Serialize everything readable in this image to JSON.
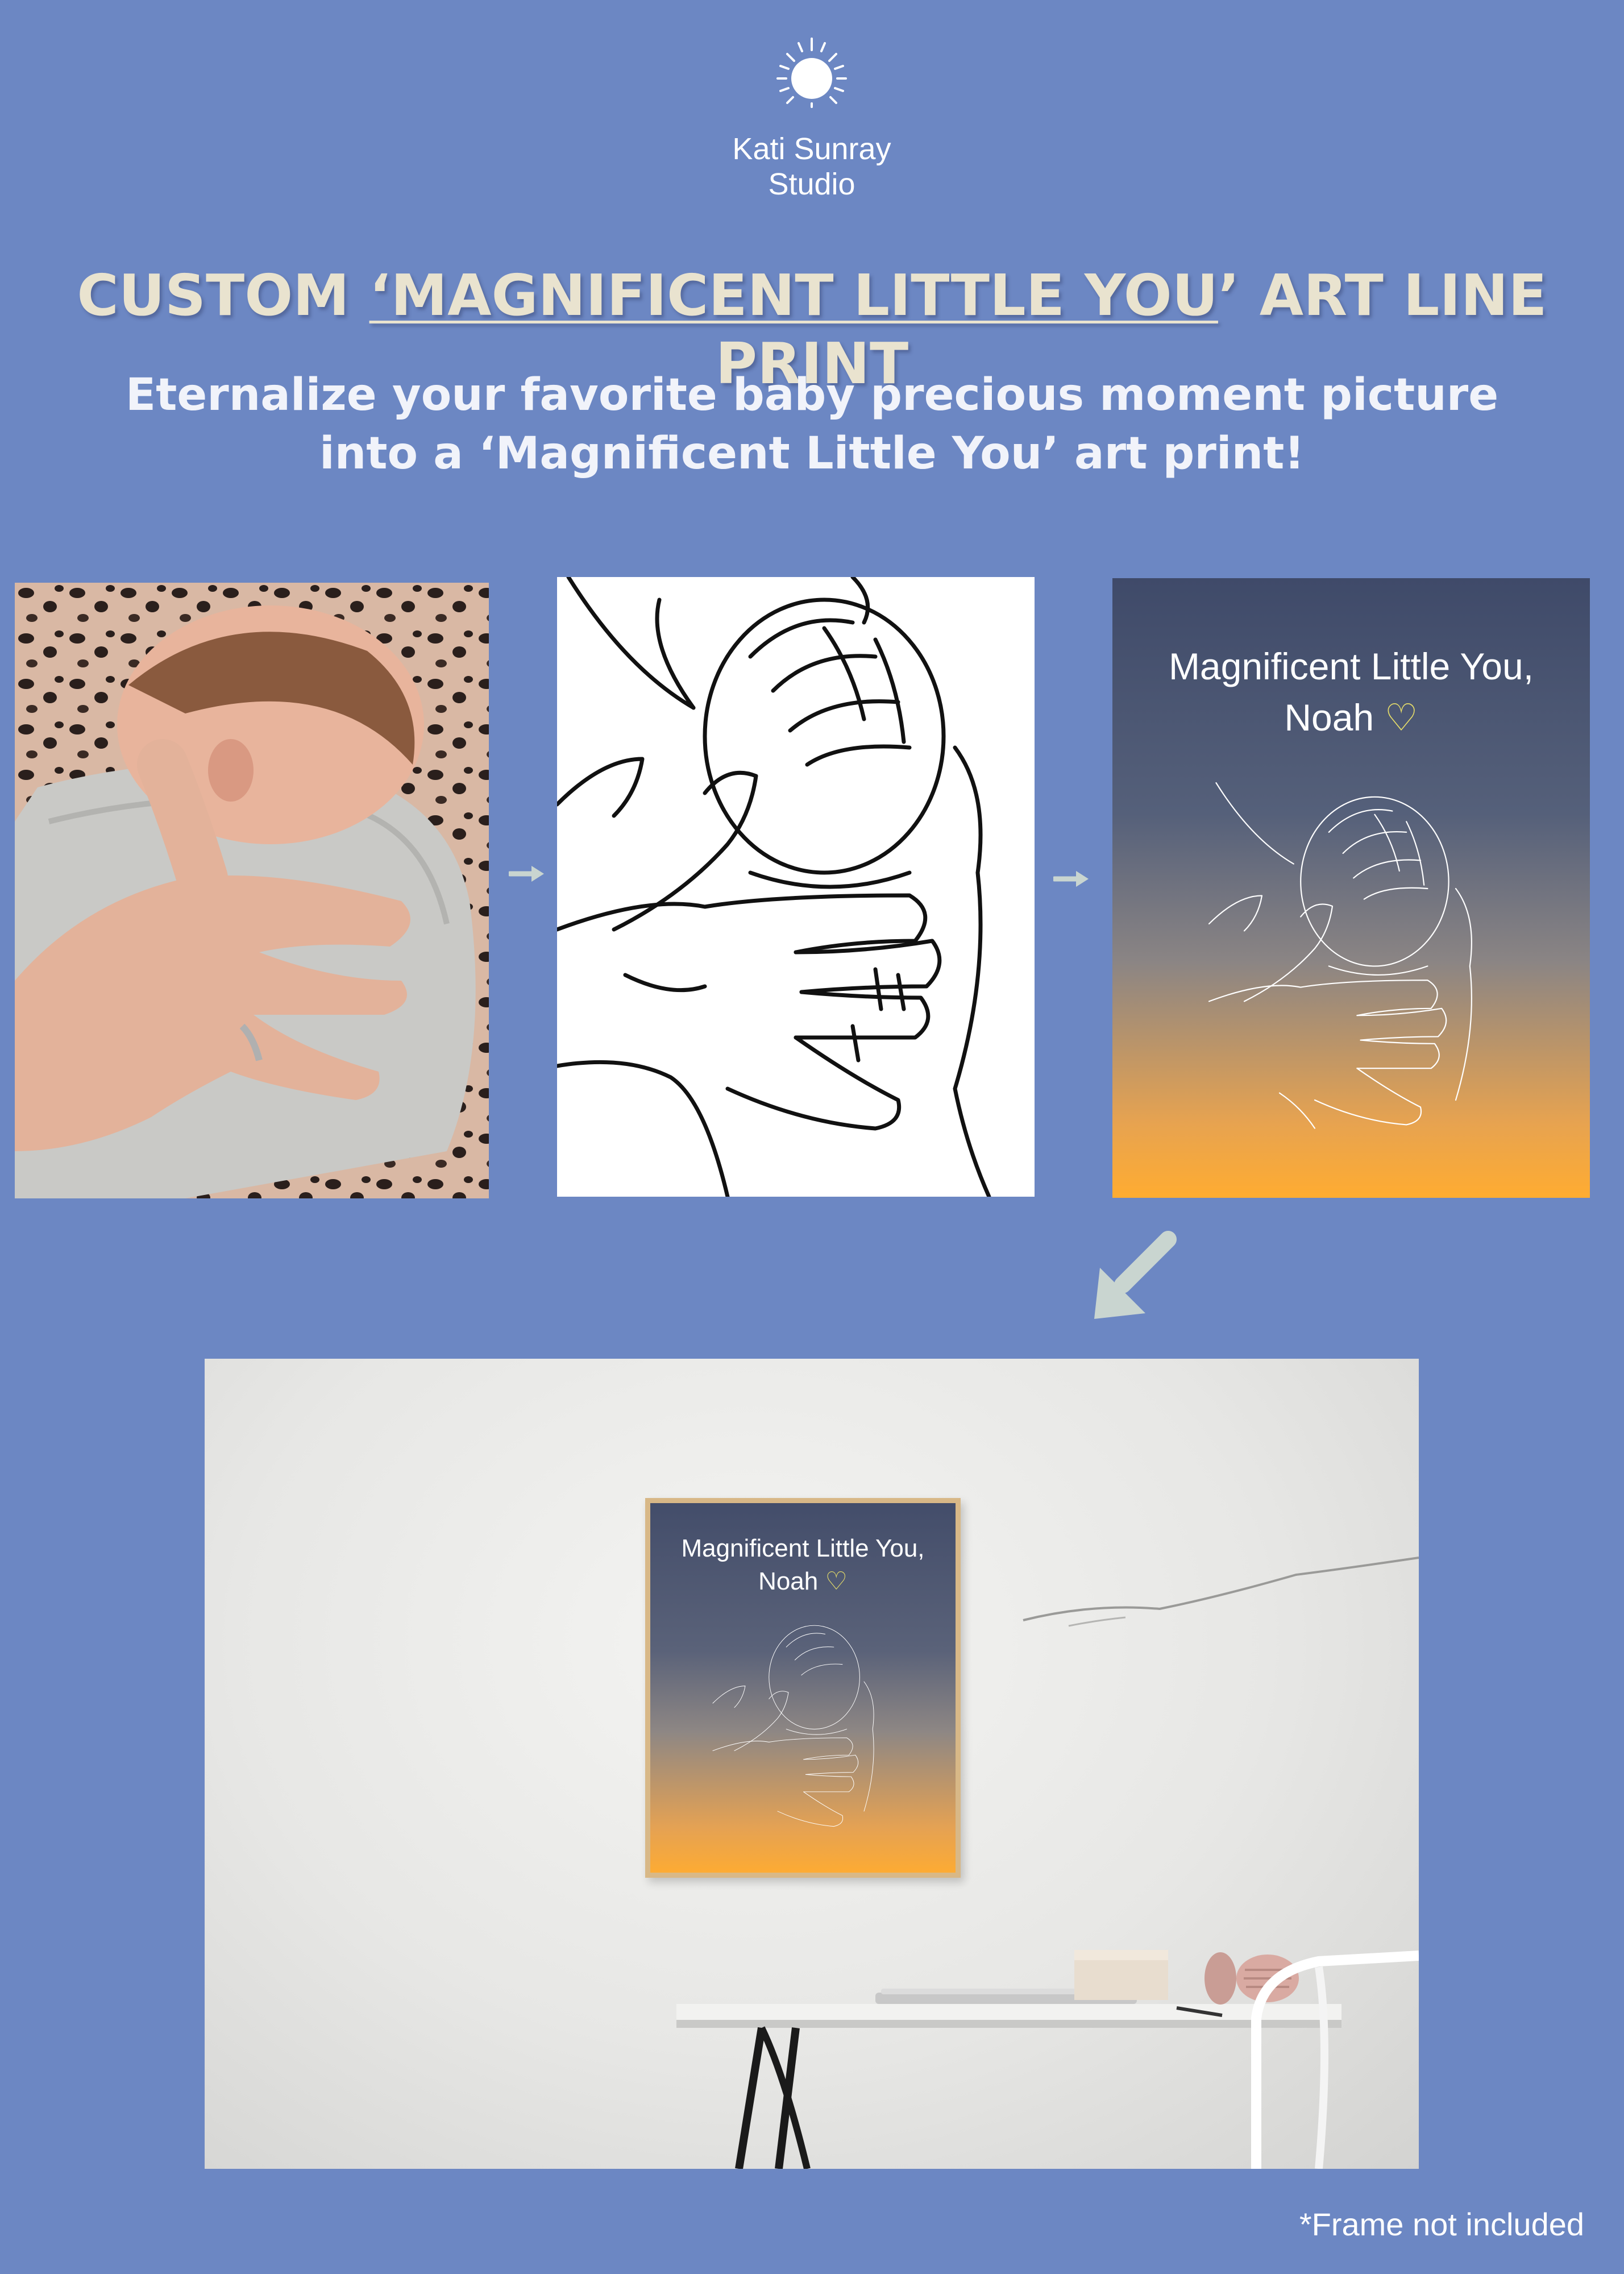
{
  "brand": {
    "line1": "Kati Sunray",
    "line2": "Studio",
    "icon": "sun-icon"
  },
  "headline": {
    "prefix": "CUSTOM ",
    "underlined": "‘MAGNIFICENT LITTLE YOU",
    "suffix": "’ ART LINE PRINT"
  },
  "subtitle": {
    "line1": "Eternalize your favorite baby precious moment picture",
    "line2": "into a ‘Magnificent Little You’ art print!"
  },
  "poster": {
    "line1": "Magnificent Little You,",
    "line2": "Noah",
    "heart": "♡"
  },
  "mockup_poster": {
    "line1": "Magnificent Little You,",
    "line2": "Noah",
    "heart": "♡"
  },
  "footnote": "*Frame not included",
  "colors": {
    "background": "#6c87c3",
    "headline": "#e9e3cf",
    "poster_top": "#3f4a69",
    "poster_bottom": "#ffac31",
    "frame": "#d8b887",
    "arrow": "#c9d5d0"
  }
}
